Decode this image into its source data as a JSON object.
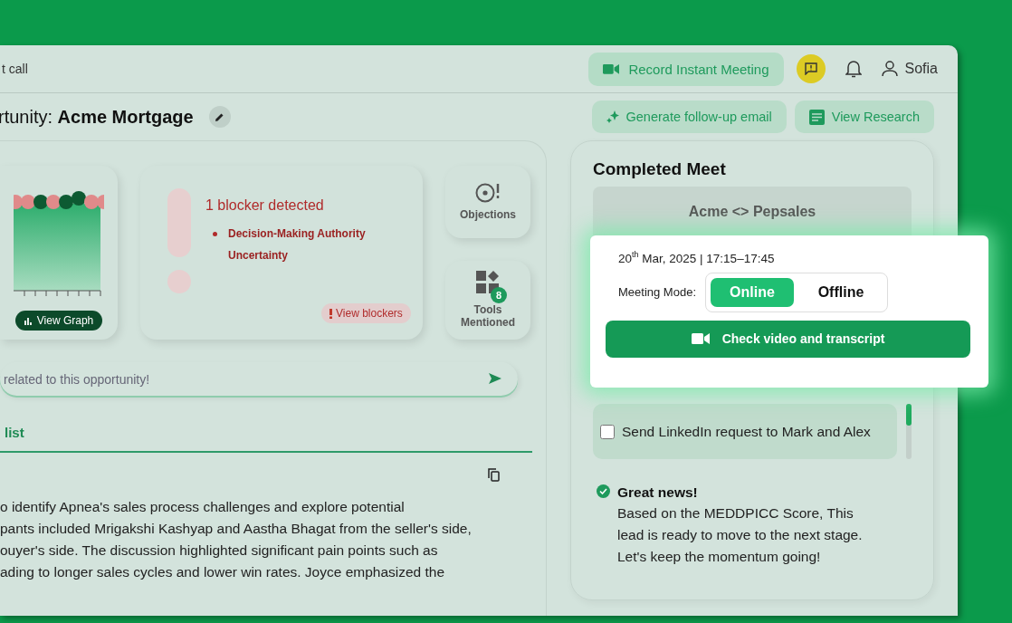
{
  "header": {
    "title": "t call",
    "record_button": "Record Instant Meeting",
    "user": "Sofia"
  },
  "opportunity": {
    "title": "rtunity: **Acme Mortgage**",
    "actions": [
      "Generate follow-up email",
      "View Research"
    ]
  },
  "graph": {
    "button": "View Graph"
  },
  "blockers": {
    "title": "1 blocker detected",
    "items": [
      "Decision-Making Authority Uncertainty"
    ],
    "button": "View blockers"
  },
  "side_cards": [
    {
      "label": "Objections"
    },
    {
      "label": "Tools Mentioned",
      "badge": "8"
    }
  ],
  "ask": {
    "placeholder": "related to this opportunity!"
  },
  "tabs": [
    {
      "label": "list",
      "selected": true
    }
  ],
  "summary_lines": [
    "o identify Apnea's sales process challenges and explore potential",
    "pants included Mrigakshi Kashyap and Aastha Bhagat from the seller's side,",
    "ouyer's side. The discussion highlighted significant pain points such as",
    "ading to longer sales cycles and lower win rates. Joyce emphasized the"
  ],
  "meeting": {
    "title": "Completed Meet",
    "name": "Acme <> Pepsales",
    "date": "20$^{th}$ Mar, 2025 | 17:15–17:45",
    "mode_label": "Meeting Mode:",
    "modes": [
      {
        "label": "Online",
        "selected": true
      },
      {
        "label": "Offline",
        "selected": false
      }
    ],
    "video_button": "Check video and transcript",
    "tasks": [
      {
        "label": "Send LinkedIn request to Mark and Alex",
        "checked": false
      }
    ],
    "notice": {
      "title": "Great news!",
      "text": "Based on the MEDDPICC Score, This lead is ready to move to the next stage. Let's keep the momentum going!"
    }
  }
}
